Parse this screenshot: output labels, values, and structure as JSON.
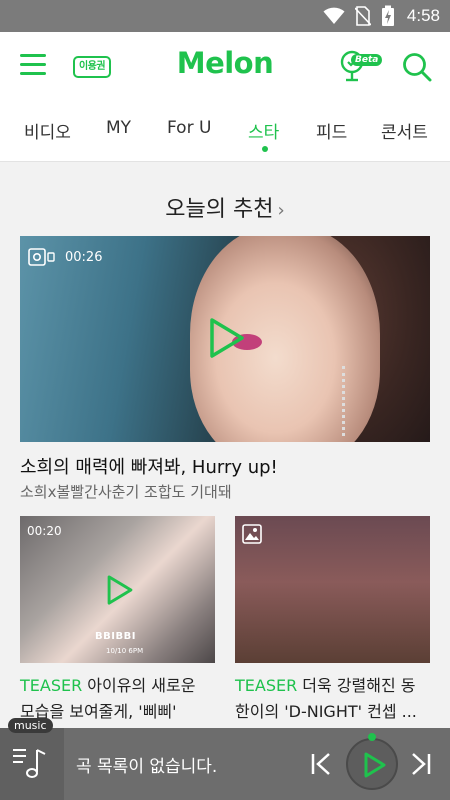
{
  "status_bar": {
    "time": "4:58"
  },
  "header": {
    "ticket_label": "이용권",
    "logo": "Melon",
    "beta_label": "Beta"
  },
  "tabs": [
    {
      "label": "비디오"
    },
    {
      "label": "MY"
    },
    {
      "label": "For U"
    },
    {
      "label": "스타",
      "active": true
    },
    {
      "label": "피드"
    },
    {
      "label": "콘서트"
    }
  ],
  "section": {
    "title": "오늘의 추천",
    "chevron": "›"
  },
  "feature": {
    "duration": "00:26",
    "title": "소희의 매력에 빠져봐, Hurry up!",
    "subtitle": "소희x볼빨간사춘기 조합도 기대돼"
  },
  "cards": [
    {
      "duration": "00:20",
      "art_text": "BBIBBI",
      "art_date": "10/10 6PM",
      "tag": "TEASER",
      "text_line1": " 아이유의 새로운",
      "text_line2": "모습을 보여줄게, '삐삐'"
    },
    {
      "tag": "TEASER",
      "text_line1": " 더욱 강렬해진 동",
      "text_line2": "한이의 'D-NIGHT' 컨셉 ..."
    }
  ],
  "player": {
    "badge": "music",
    "empty_text": "곡 목록이 없습니다."
  },
  "colors": {
    "accent": "#1fc24d",
    "status_bar": "#7b7b7b",
    "player_bg": "#6d6d6d"
  },
  "icons": [
    "wifi-icon",
    "no-sim-icon",
    "battery-charging-icon",
    "menu-icon",
    "mic-icon",
    "search-icon",
    "video-icon",
    "image-icon",
    "play-icon",
    "playlist-icon",
    "prev-icon",
    "next-icon"
  ]
}
